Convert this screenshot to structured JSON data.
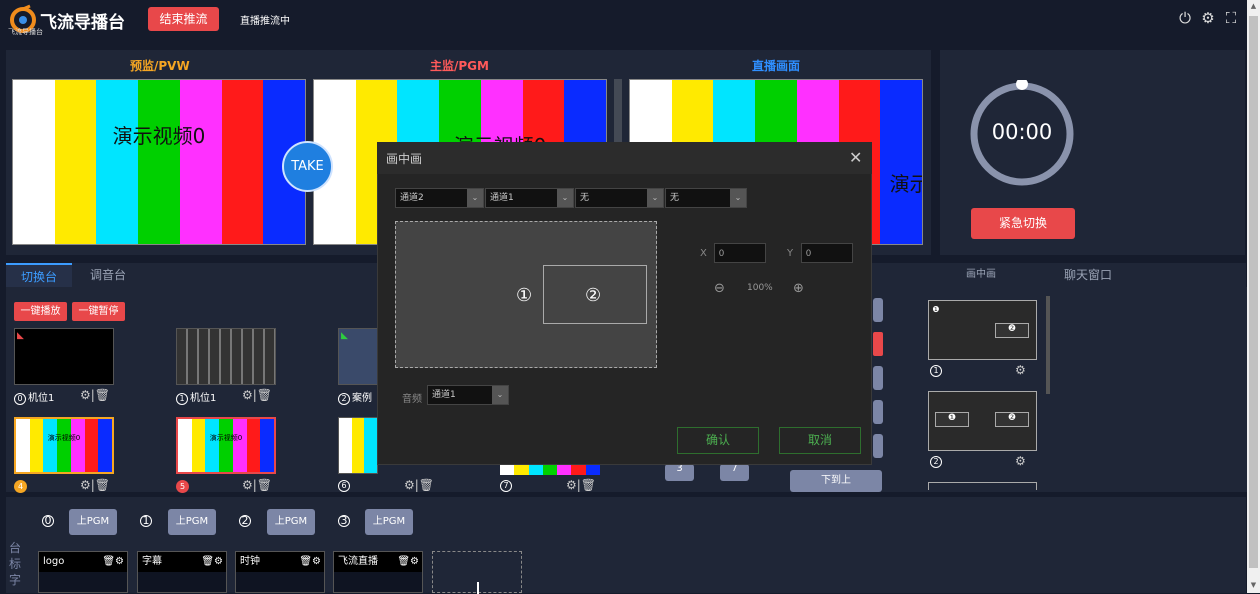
{
  "header": {
    "brand": "飞流导播台",
    "brand_sub": "飞流导播台",
    "end_button": "结束推流",
    "status": "直播推流中"
  },
  "icons": [
    "power-icon",
    "settings-icon",
    "fullscreen-icon"
  ],
  "monitors": {
    "preview_title": "预监/PVW",
    "program_title": "主监/PGM",
    "live_title": "直播画面",
    "screen_text": "演示视频0",
    "take": "TAKE",
    "colors": {
      "preview": "#f5a623",
      "program": "#ff5a5a",
      "live": "#2f8fff"
    }
  },
  "timer": {
    "time": "00:00",
    "emergency": "紧急切换"
  },
  "tabs": {
    "switcher": "切换台",
    "audio": "调音台",
    "pip": "画中画",
    "chat": "聊天窗口"
  },
  "controls": {
    "play_all": "一键播放",
    "pause_all": "一键暂停"
  },
  "cameras": [
    {
      "num": "0",
      "label": "机位1"
    },
    {
      "num": "1",
      "label": "机位1"
    },
    {
      "num": "2",
      "label": "案例"
    }
  ],
  "sources": [
    {
      "num": "4"
    },
    {
      "num": "5"
    },
    {
      "num": "6"
    },
    {
      "num": "7"
    }
  ],
  "source_text": "演示视频0",
  "keypad": {
    "k3": "3",
    "k7": "7",
    "move_down": "下到上"
  },
  "pgm_channels": [
    {
      "num": "0",
      "label": "上PGM"
    },
    {
      "num": "1",
      "label": "上PGM"
    },
    {
      "num": "2",
      "label": "上PGM"
    },
    {
      "num": "3",
      "label": "上PGM"
    }
  ],
  "overlays": [
    {
      "name": "logo"
    },
    {
      "name": "字幕"
    },
    {
      "name": "时钟"
    },
    {
      "name": "飞流直播"
    }
  ],
  "side_text": "台标字",
  "pip_cards": [
    {
      "num": "1"
    },
    {
      "num": "2"
    }
  ],
  "modal": {
    "title": "画中画",
    "selects": [
      "通道2",
      "通道1",
      "无",
      "无"
    ],
    "canvas_main": "①",
    "canvas_inner": "②",
    "x_label": "X",
    "y_label": "Y",
    "x_value": "0",
    "y_value": "0",
    "zoom": "100%",
    "audio_label": "音频",
    "audio_value": "通道1",
    "confirm": "确认",
    "cancel": "取消"
  }
}
